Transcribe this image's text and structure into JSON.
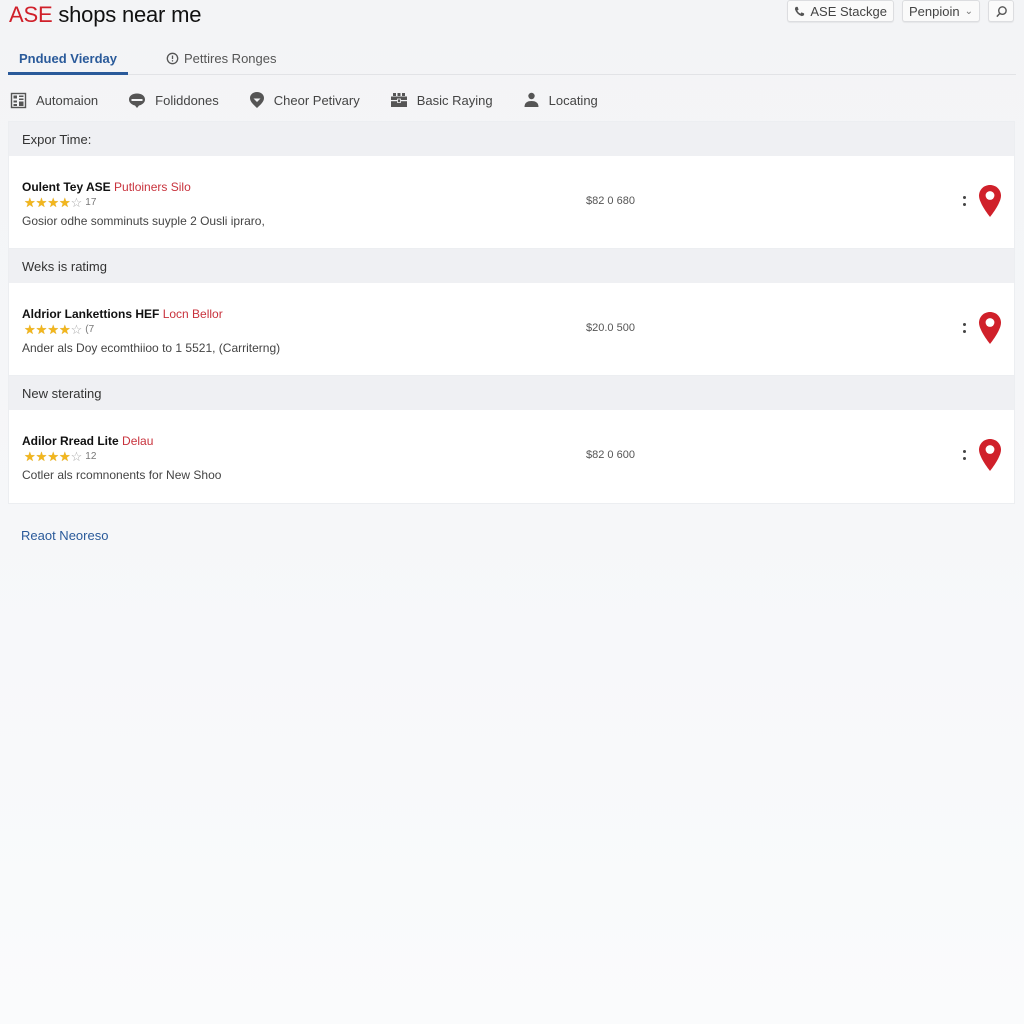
{
  "header": {
    "title_accent": "ASE",
    "title_rest": " shops near me",
    "actions": [
      {
        "label": "ASE Stackge",
        "icon": "phone-icon"
      },
      {
        "label": "Penpioin",
        "icon": "chevron-down-icon"
      },
      {
        "label": "",
        "icon": "search-icon"
      }
    ]
  },
  "tabs": [
    {
      "label": "Pndued Vierday",
      "active": true
    },
    {
      "label": "Pettires Ronges",
      "icon": "clock-icon",
      "active": false
    }
  ],
  "filters": [
    {
      "label": "Automaion",
      "icon": "grid-building-icon"
    },
    {
      "label": "Foliddones",
      "icon": "badge-icon"
    },
    {
      "label": "Cheor Petivary",
      "icon": "shield-icon"
    },
    {
      "label": "Basic Raying",
      "icon": "toolbox-icon"
    },
    {
      "label": "Locating",
      "icon": "person-icon"
    }
  ],
  "sections": [
    {
      "heading": "Expor Time:",
      "item": {
        "name": "Oulent Tey ASE",
        "tag": "Putloiners Silo",
        "rating": 4,
        "rating_max": 5,
        "review_count": "17",
        "description": "Gosior odhe somminuts suyple 2 Ousli ipraro,",
        "price": "$82 0 680"
      }
    },
    {
      "heading": "Weks is ratimg",
      "item": {
        "name": "Aldrior Lankettions HEF",
        "tag": "Locn Bellor",
        "rating": 4,
        "rating_max": 5,
        "review_count": "(7",
        "description": "Ander als Doy ecomthiioo to 1 5521, (Carriterng)",
        "price": "$20.0 500"
      }
    },
    {
      "heading": "New sterating",
      "item": {
        "name": "Adilor Rread Lite",
        "tag": "Delau",
        "rating": 4,
        "rating_max": 5,
        "review_count": "12",
        "description": "Cotler als rcomnonents for New Shoo",
        "price": "$82 0 600"
      }
    }
  ],
  "footer": {
    "link_label": "Reaot Neoreso"
  },
  "colors": {
    "accent_red": "#d0202a",
    "link_blue": "#2a5a9a",
    "star_gold": "#f2b61e",
    "pin_red": "#d0202a"
  }
}
